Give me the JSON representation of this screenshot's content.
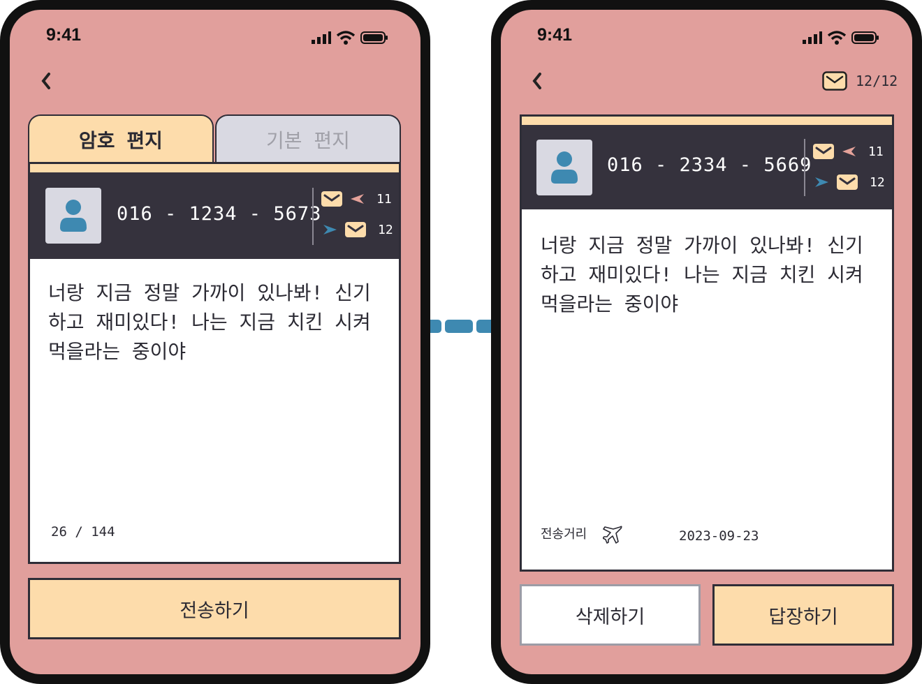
{
  "left": {
    "status_time": "9:41",
    "tabs": [
      {
        "label": "암호 편지",
        "active": true
      },
      {
        "label": "기본 편지",
        "active": false
      }
    ],
    "phone_number": "016 - 1234 - 5673",
    "received_count": "11",
    "sent_count": "12",
    "message": "너랑 지금 정말 가까이 있나봐! 신기하고 재미있다! 나는 지금 치킨 시켜 먹을라는 중이야",
    "char_count": "26 / 144",
    "send_button": "전송하기"
  },
  "right": {
    "status_time": "9:41",
    "letter_counter": "12/12",
    "phone_number": "016 - 2334 - 5669",
    "received_count": "11",
    "sent_count": "12",
    "message": "너랑 지금 정말 가까이 있나봐! 신기하고 재미있다! 나는 지금 치킨 시켜 먹을라는 중이야",
    "distance_label": "전송거리",
    "date": "2023-09-23",
    "delete_button": "삭제하기",
    "reply_button": "답장하기"
  },
  "colors": {
    "background": "#e19f9c",
    "dark": "#35323d",
    "peach": "#fddcab",
    "gray": "#d9d9e2",
    "blue": "#3e89b1",
    "pink_arrow": "#e5a29a"
  },
  "icons": [
    "signal-icon",
    "wifi-icon",
    "battery-icon",
    "back-icon",
    "user-icon",
    "envelope-icon",
    "arrow-left-icon",
    "arrow-right-icon",
    "airplane-icon"
  ]
}
